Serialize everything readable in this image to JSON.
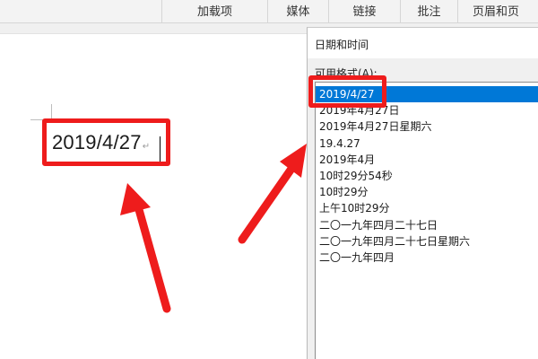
{
  "ribbon": {
    "groups": [
      "加载项",
      "媒体",
      "链接",
      "批注",
      "页眉和页"
    ]
  },
  "document": {
    "inserted_date": "2019/4/27",
    "paragraph_mark": "↵"
  },
  "dialog": {
    "title": "日期和时间",
    "formats_label": "可用格式(A):",
    "formats": [
      "2019/4/27",
      "2019年4月27日",
      "2019年4月27日星期六",
      "19.4.27",
      "2019年4月",
      "10时29分54秒",
      "10时29分",
      "上午10时29分",
      "二〇一九年四月二十七日",
      "二〇一九年四月二十七日星期六",
      "二〇一九年四月"
    ],
    "selected_index": 0
  },
  "colors": {
    "highlight": "#ee1c1c",
    "selection": "#0078d7"
  }
}
